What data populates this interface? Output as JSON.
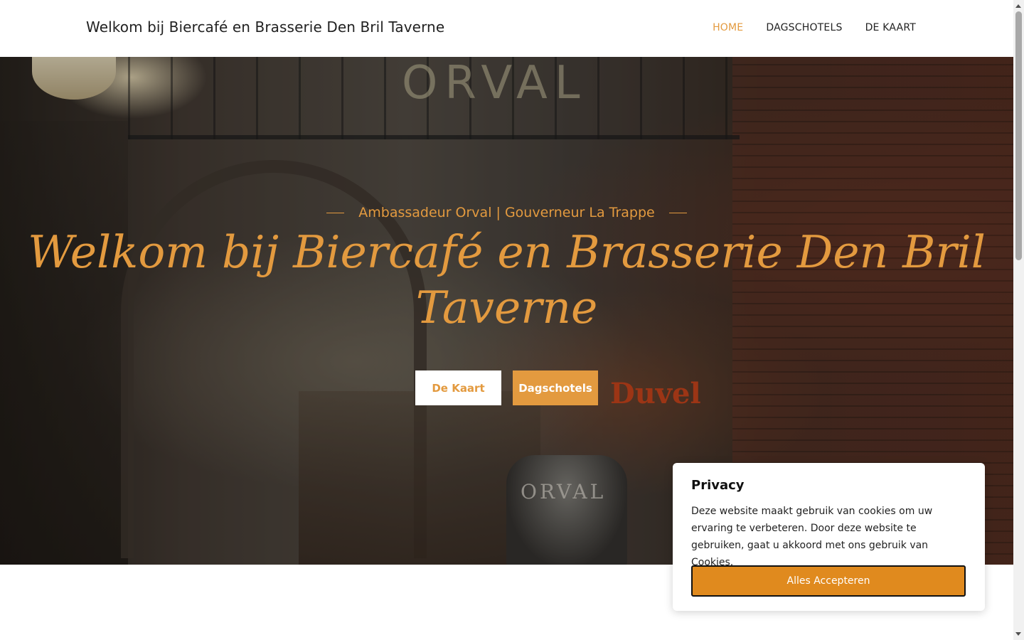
{
  "site": {
    "title": "Welkom bij Biercafé en Brasserie Den Bril Taverne"
  },
  "nav": {
    "items": [
      {
        "label": "HOME",
        "active": true
      },
      {
        "label": "DAGSCHOTELS",
        "active": false
      },
      {
        "label": "DE KAART",
        "active": false
      }
    ]
  },
  "hero": {
    "tagline": "Ambassadeur Orval | Gouverneur La Trappe",
    "title": "Welkom bij Biercafé en Brasserie Den Bril Taverne",
    "buttons": {
      "kaart": "De Kaart",
      "dagschotels": "Dagschotels"
    },
    "photo_signs": {
      "neon": "ORVAL",
      "duvel": "Duvel",
      "barrel": "ORVAL"
    }
  },
  "cookie": {
    "title": "Privacy",
    "text": "Deze website maakt gebruik van cookies om uw ervaring te verbeteren. Door deze website te gebruiken, gaat u akkoord met ons gebruik van Cookies.",
    "accept": "Alles Accepteren"
  },
  "colors": {
    "accent": "#e39a3f",
    "button": "#e08a1e"
  }
}
